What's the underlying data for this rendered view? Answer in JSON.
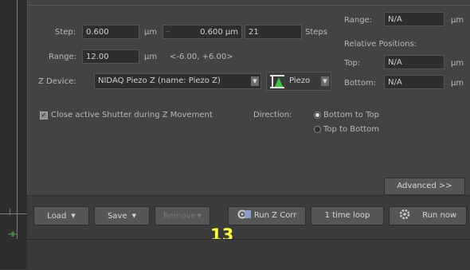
{
  "z_stack": {
    "step_label": "Step:",
    "step_value": "0.600",
    "step_unit": "µm",
    "step_spin_value": "0.600 µm",
    "step_count": "21",
    "steps_label": "Steps",
    "range_label": "Range:",
    "range_value": "12.00",
    "range_unit": "µm",
    "range_bounds": "<-6.00, +6.00>",
    "zdevice_label": "Z Device:",
    "zdevice_value": "NIDAQ Piezo Z (name: Piezo Z)",
    "piezo_value": "Piezo",
    "close_shutter_label": "Close active Shutter during Z Movement",
    "direction_label": "Direction:",
    "dir_bottom_to_top": "Bottom to Top",
    "dir_top_to_bottom": "Top to Bottom"
  },
  "right_panel": {
    "range_label": "Range:",
    "range_value": "N/A",
    "range_unit": "µm",
    "relative_positions_label": "Relative Positions:",
    "top_label": "Top:",
    "top_value": "N/A",
    "top_unit": "µm",
    "bottom_label": "Bottom:",
    "bottom_value": "N/A",
    "bottom_unit": "µm"
  },
  "advanced_label": "Advanced >>",
  "buttons": {
    "load": "Load",
    "save": "Save",
    "remove": "Remove",
    "run_z_corr": "Run Z Corr",
    "time_loop": "1 time loop",
    "run_now": "Run now"
  },
  "annotation_number": "13",
  "colors": {
    "panel_bg": "#434343",
    "annotation": "#ffff33",
    "piezo_icon_green": "#3cc83c"
  },
  "icons": {
    "run_z_corr": "z-correction-icon",
    "run_now": "run-gear-icon",
    "piezo": "piezo-device-icon"
  }
}
